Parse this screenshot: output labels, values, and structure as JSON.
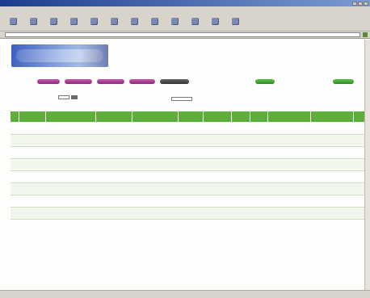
{
  "window": {
    "title": ""
  },
  "menu": {
    "items": [
      "",
      "",
      "",
      "",
      "",
      ""
    ]
  },
  "toolbar": {
    "buttons": [
      {
        "label": "",
        "icon": "back-icon"
      },
      {
        "label": "",
        "icon": "forward-icon"
      },
      {
        "label": "",
        "icon": "stop-icon"
      },
      {
        "label": "",
        "icon": "refresh-icon"
      },
      {
        "label": "",
        "icon": "home-icon"
      },
      {
        "label": "",
        "icon": "search-icon"
      },
      {
        "label": "",
        "icon": "favorites-icon"
      },
      {
        "label": "",
        "icon": "history-icon"
      },
      {
        "label": "",
        "icon": "mail-icon"
      },
      {
        "label": "",
        "icon": "print-icon"
      },
      {
        "label": "",
        "icon": "edit-icon"
      },
      {
        "label": "",
        "icon": "discuss-icon"
      }
    ]
  },
  "address": {
    "label": "",
    "value": ""
  },
  "brand": {
    "line1": "",
    "line2": ""
  },
  "nav": {
    "pills": [
      {
        "label": "",
        "color": "#b04aa0"
      },
      {
        "label": "",
        "color": "#b04aa0"
      },
      {
        "label": "",
        "color": "#b04aa0"
      },
      {
        "label": "",
        "color": "#b04aa0"
      },
      {
        "label": "",
        "color": "#444444"
      },
      {
        "label": "",
        "color": "#3fa02f"
      },
      {
        "label": "",
        "color": "#3fa02f"
      }
    ]
  },
  "form": {
    "records_label": "",
    "sort_label": ""
  },
  "table": {
    "columns": [
      "",
      "",
      "",
      "",
      "",
      "",
      "",
      "",
      "",
      "",
      "",
      ""
    ],
    "rows": [
      [
        "",
        "",
        "",
        "",
        "",
        "",
        "",
        "",
        "",
        "",
        "",
        ""
      ],
      [
        "",
        "",
        "",
        "",
        "",
        "",
        "",
        "",
        "",
        "",
        "",
        ""
      ],
      [
        "",
        "",
        "",
        "",
        "",
        "",
        "",
        "",
        "",
        "",
        "",
        ""
      ],
      [
        "",
        "",
        "",
        "",
        "",
        "",
        "",
        "",
        "",
        "",
        "",
        ""
      ],
      [
        "",
        "",
        "",
        "",
        "",
        "",
        "",
        "",
        "",
        "",
        "",
        ""
      ],
      [
        "",
        "",
        "",
        "",
        "",
        "",
        "",
        "",
        "",
        "",
        "",
        ""
      ],
      [
        "",
        "",
        "",
        "",
        "",
        "",
        "",
        "",
        "",
        "",
        "",
        ""
      ],
      [
        "",
        "",
        "",
        "",
        "",
        "",
        "",
        "",
        "",
        "",
        "",
        ""
      ]
    ]
  },
  "footnote": "",
  "colors": {
    "accent_green": "#5fae3a",
    "brand_red": "#c0142c",
    "nav_magenta": "#b04aa0"
  }
}
